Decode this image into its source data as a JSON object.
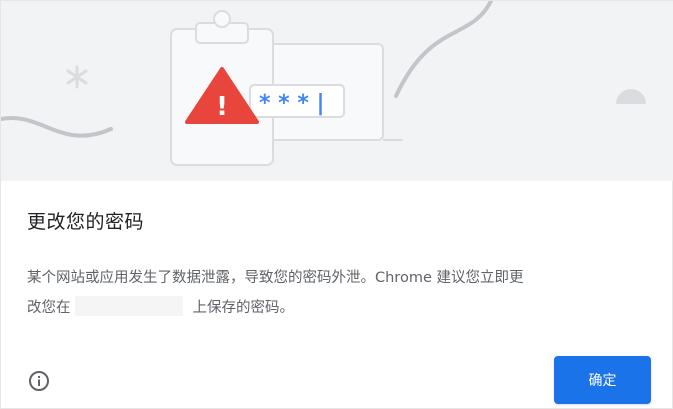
{
  "illustration": {
    "password_mask": "* * * |",
    "warning_glyph": "!",
    "icons": [
      "clipboard-icon",
      "warning-triangle-icon",
      "password-field-icon",
      "asterisk-decoration-icon"
    ]
  },
  "dialog": {
    "title": "更改您的密码",
    "body_line1": "某个网站或应用发生了数据泄露，导致您的密码外泄。Chrome 建议您立即更",
    "body_line2_prefix": "改您在",
    "body_line2_suffix": "上保存的密码。",
    "ok_label": "确定",
    "info_icon": "info-icon"
  },
  "colors": {
    "accent": "#1a73e8",
    "warning": "#e8453c",
    "illustration_bg": "#f1f3f4",
    "title_text": "#202124",
    "body_text": "#5f6368"
  }
}
